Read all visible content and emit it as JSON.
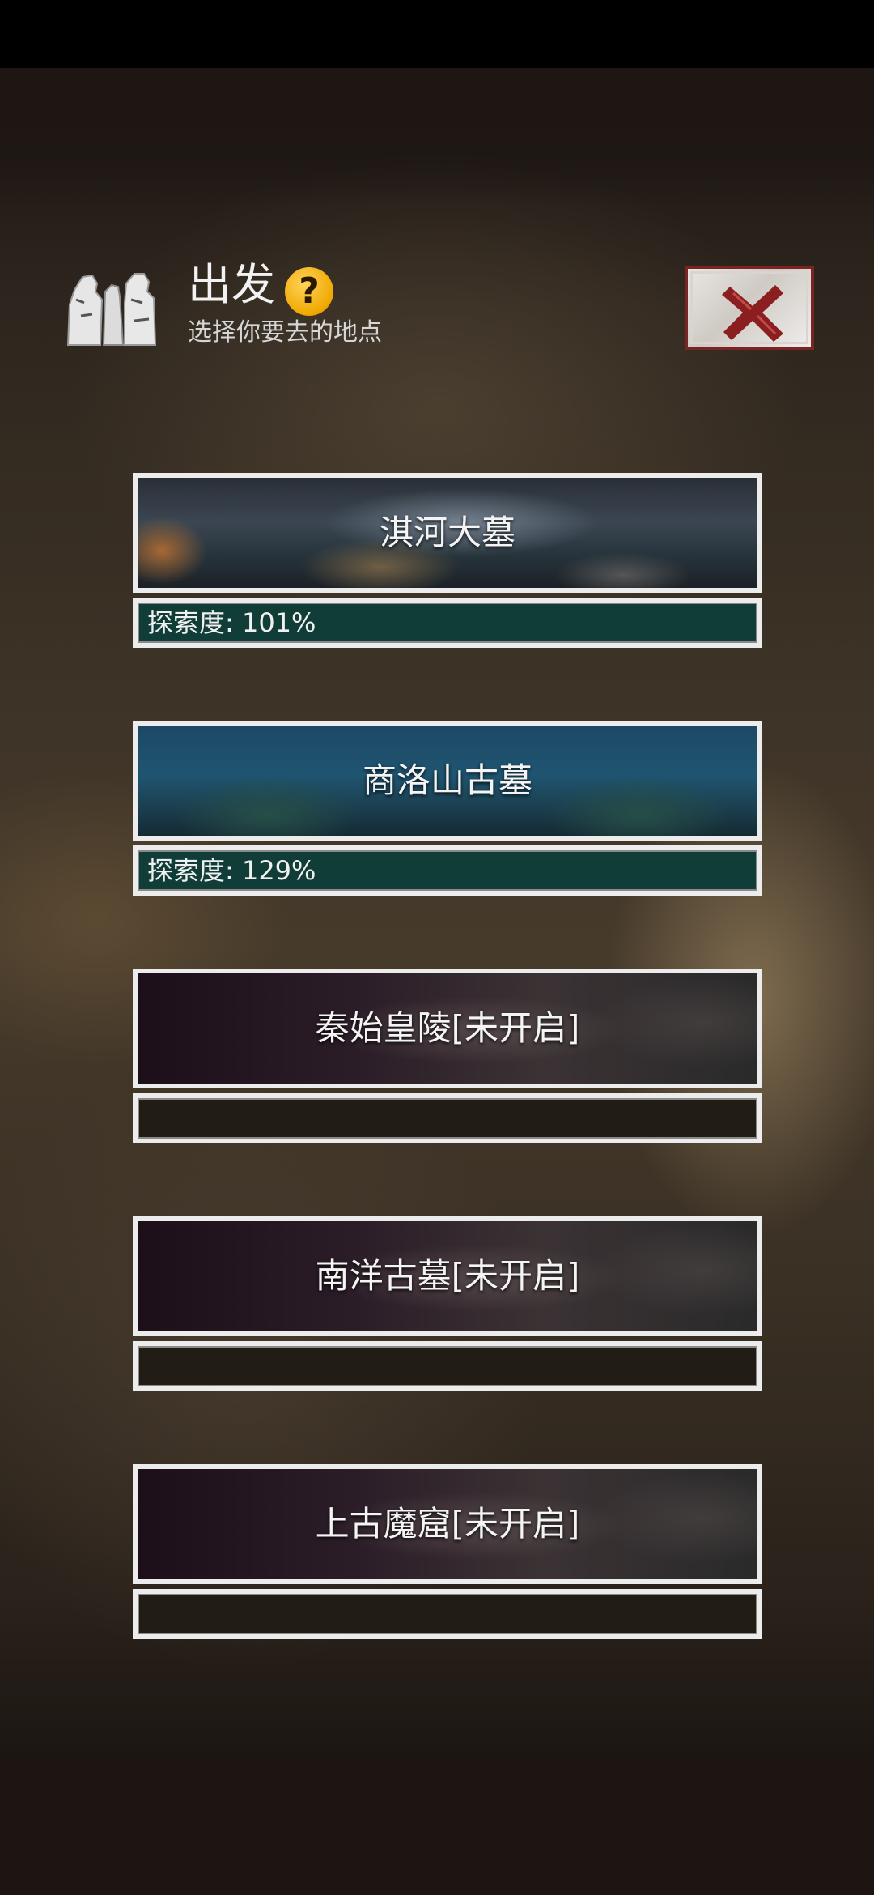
{
  "header": {
    "title": "出发",
    "help_icon": "?",
    "subtitle": "选择你要去的地点",
    "icon": "travelers-icon",
    "close_icon": "close-x-icon"
  },
  "locations": [
    {
      "name": "淇河大墓",
      "progress_label": "探索度: 101%",
      "exploration_percent": 101,
      "locked": false
    },
    {
      "name": "商洛山古墓",
      "progress_label": "探索度: 129%",
      "exploration_percent": 129,
      "locked": false
    },
    {
      "name": "秦始皇陵[未开启]",
      "progress_label": "",
      "locked": true
    },
    {
      "name": "南洋古墓[未开启]",
      "progress_label": "",
      "locked": true
    },
    {
      "name": "上古魔窟[未开启]",
      "progress_label": "",
      "locked": true
    }
  ],
  "colors": {
    "progress_unlocked": "#103d37",
    "progress_locked": "#211d14",
    "close_border": "#7a2424",
    "help_badge": "#f0a800"
  }
}
